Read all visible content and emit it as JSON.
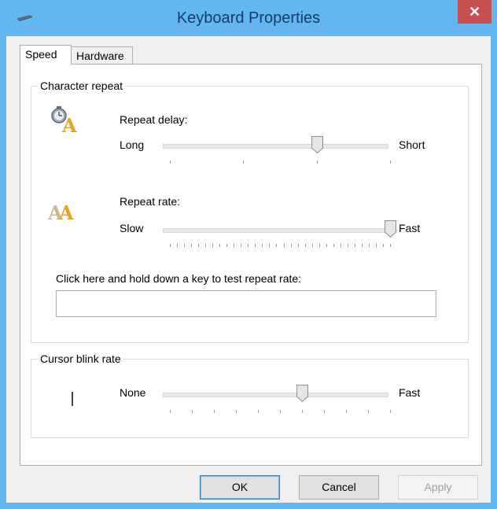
{
  "window": {
    "title": "Keyboard Properties",
    "close_label": "✕"
  },
  "tabs": [
    {
      "label": "Speed",
      "active": true
    },
    {
      "label": "Hardware",
      "active": false
    }
  ],
  "character_repeat": {
    "group_label": "Character repeat",
    "repeat_delay": {
      "label": "Repeat delay:",
      "min_label": "Long",
      "max_label": "Short",
      "value": 2,
      "max": 3,
      "icon": "clock-letter-a-icon"
    },
    "repeat_rate": {
      "label": "Repeat rate:",
      "min_label": "Slow",
      "max_label": "Fast",
      "value": 31,
      "max": 31,
      "icon": "double-letter-a-icon"
    },
    "test": {
      "label": "Click here and hold down a key to test repeat rate:",
      "value": ""
    }
  },
  "cursor_blink": {
    "group_label": "Cursor blink rate",
    "min_label": "None",
    "max_label": "Fast",
    "value": 6,
    "max": 10,
    "icon": "text-cursor-icon"
  },
  "buttons": {
    "ok": "OK",
    "cancel": "Cancel",
    "apply": "Apply"
  },
  "colors": {
    "title_bar": "#61b7ee",
    "close_button": "#c75050"
  }
}
